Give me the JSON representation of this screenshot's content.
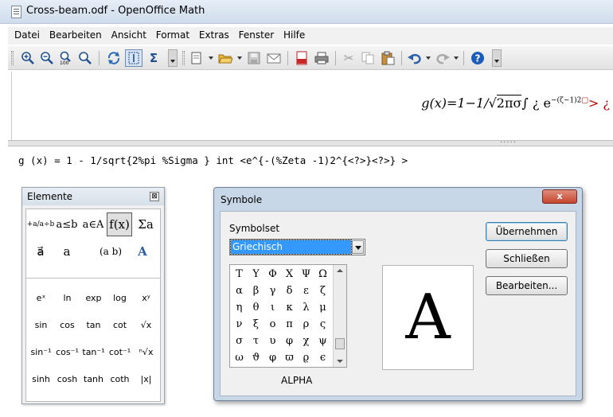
{
  "window": {
    "title": "Cross-beam.odf - OpenOffice Math"
  },
  "menu": [
    "Datei",
    "Bearbeiten",
    "Ansicht",
    "Format",
    "Extras",
    "Fenster",
    "Hilfe"
  ],
  "toolbar": {
    "icons": [
      "zoom-in-icon",
      "zoom-out-icon",
      "zoom-100-icon",
      "show-all-icon",
      "update-icon",
      "formula-cursor-icon",
      "symbols-icon",
      "new-icon",
      "open-icon",
      "save-icon",
      "email-icon",
      "export-pdf-icon",
      "print-icon",
      "cut-icon",
      "copy-icon",
      "paste-icon",
      "undo-icon",
      "redo-icon",
      "help-icon"
    ]
  },
  "formula": {
    "rendered_lhs": "g(x)=1−1/",
    "rendered_sqrt": "2πσ",
    "rendered_int": "∫ ¿ e",
    "rendered_exp": "−(ζ−1)2",
    "rendered_exp_box": "□",
    "rendered_tail": "> ¿",
    "command": "g (x) = 1 - 1/sqrt{2%pi %Sigma } int <e^{-(%Zeta -1)2^{<?>}<?>} >"
  },
  "elemente": {
    "title": "Elemente",
    "close": "⊠",
    "categories": [
      "+a/a÷b",
      "a≤b",
      "a∈A",
      "f(x)",
      "Σa",
      "a⃗",
      "a",
      "(a b)",
      "A"
    ],
    "functions": [
      "eˣ",
      "ln",
      "exp",
      "log",
      "xʸ",
      "sin",
      "cos",
      "tan",
      "cot",
      "√x",
      "sin⁻¹",
      "cos⁻¹",
      "tan⁻¹",
      "cot⁻¹",
      "ⁿ√x",
      "sinh",
      "cosh",
      "tanh",
      "coth",
      "|x|"
    ]
  },
  "symbole": {
    "title": "Symbole",
    "close": "x",
    "symbolset_label": "Symbolset",
    "symbolset_value": "Griechisch",
    "symbols": [
      "Τ",
      "Υ",
      "Φ",
      "Χ",
      "Ψ",
      "Ω",
      "α",
      "β",
      "γ",
      "δ",
      "ε",
      "ζ",
      "η",
      "θ",
      "ι",
      "κ",
      "λ",
      "μ",
      "ν",
      "ξ",
      "ο",
      "π",
      "ρ",
      "ς",
      "σ",
      "τ",
      "υ",
      "φ",
      "χ",
      "ψ",
      "ω",
      "ϑ",
      "φ",
      "ϖ",
      "ϱ",
      "ϵ"
    ],
    "selected_name": "ALPHA",
    "preview_glyph": "A",
    "buttons": {
      "apply": "Übernehmen",
      "close": "Schließen",
      "edit": "Bearbeiten..."
    }
  }
}
